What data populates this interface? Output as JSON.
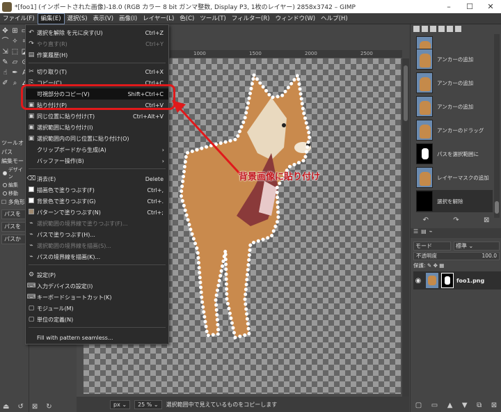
{
  "window": {
    "title": "*[foo1] (インポートされた画像)-18.0 (RGB カラー 8 bit ガンマ整数, Display P3, 1枚のレイヤー) 2858x3742 – GIMP",
    "minimize": "–",
    "maximize": "☐",
    "close": "✕"
  },
  "menubar": [
    "ファイル(F)",
    "編集(E)",
    "選択(S)",
    "表示(V)",
    "画像(I)",
    "レイヤー(L)",
    "色(C)",
    "ツール(T)",
    "フィルター(R)",
    "ウィンドウ(W)",
    "ヘルプ(H)"
  ],
  "edit_menu": {
    "items": [
      {
        "icon": "↶",
        "label": "選択を解除 を元に戻す(U)",
        "shortcut": "Ctrl+Z",
        "disabled": false
      },
      {
        "icon": "↷",
        "label": "やり直す(R)",
        "shortcut": "Ctrl+Y",
        "disabled": true
      },
      {
        "icon": "▤",
        "label": "作業履歴(H)",
        "shortcut": "",
        "disabled": false
      },
      {
        "icon": "✂",
        "label": "切り取り(T)",
        "shortcut": "Ctrl+X",
        "disabled": false
      },
      {
        "icon": "⎘",
        "label": "コピー(C)",
        "shortcut": "Ctrl+C",
        "disabled": false
      },
      {
        "icon": "",
        "label": "可視部分のコピー(V)",
        "shortcut": "Shift+Ctrl+C",
        "disabled": false
      },
      {
        "icon": "▣",
        "label": "貼り付け(P)",
        "shortcut": "Ctrl+V",
        "disabled": false
      },
      {
        "icon": "▣",
        "label": "同じ位置に貼り付け(T)",
        "shortcut": "Ctrl+Alt+V",
        "disabled": false
      },
      {
        "icon": "▣",
        "label": "選択範囲に貼り付け(I)",
        "shortcut": "",
        "disabled": false
      },
      {
        "icon": "▣",
        "label": "選択範囲内の同じ位置に貼り付け(O)",
        "shortcut": "",
        "disabled": false
      },
      {
        "icon": "",
        "label": "クリップボードから生成(A)",
        "shortcut": "",
        "disabled": false,
        "submenu": true
      },
      {
        "icon": "",
        "label": "バッファー操作(B)",
        "shortcut": "",
        "disabled": false,
        "submenu": true
      },
      {
        "icon": "⌫",
        "label": "消去(E)",
        "shortcut": "Delete",
        "disabled": false
      },
      {
        "icon": "■",
        "label": "描画色で塗りつぶす(F)",
        "shortcut": "Ctrl+,",
        "disabled": false
      },
      {
        "icon": "□",
        "label": "背景色で塗りつぶす(G)",
        "shortcut": "Ctrl+.",
        "disabled": false
      },
      {
        "icon": "▦",
        "label": "パターンで塗りつぶす(N)",
        "shortcut": "Ctrl+;",
        "disabled": false
      },
      {
        "icon": "⌁",
        "label": "選択範囲の境界線で塗りつぶす(F)...",
        "shortcut": "",
        "disabled": true
      },
      {
        "icon": "⌁",
        "label": "パスで塗りつぶす(H)...",
        "shortcut": "",
        "disabled": false
      },
      {
        "icon": "⌁",
        "label": "選択範囲の境界線を描画(S)...",
        "shortcut": "",
        "disabled": true
      },
      {
        "icon": "⌁",
        "label": "パスの境界線を描画(K)...",
        "shortcut": "",
        "disabled": false
      },
      {
        "icon": "⚙",
        "label": "設定(P)",
        "shortcut": "",
        "disabled": false
      },
      {
        "icon": "⌨",
        "label": "入力デバイスの設定(I)",
        "shortcut": "",
        "disabled": false
      },
      {
        "icon": "⌨",
        "label": "キーボードショートカット(K)",
        "shortcut": "",
        "disabled": false
      },
      {
        "icon": "▢",
        "label": "モジュール(M)",
        "shortcut": "",
        "disabled": false
      },
      {
        "icon": "▢",
        "label": "単位の定義(N)",
        "shortcut": "",
        "disabled": false
      },
      {
        "icon": "",
        "label": "Fill with pattern seamless...",
        "shortcut": "",
        "disabled": false
      }
    ]
  },
  "annotation": {
    "text": "背景画像に貼り付け",
    "color": "#e0191b"
  },
  "toolbox": {
    "tool_options_label": "ツールオ",
    "paths_label": "パス",
    "edit_mode_label": "編集モード",
    "mode_options": [
      "デザイン",
      "編集",
      "移動"
    ],
    "polygon_label": "多角形",
    "path_buttons": [
      "パスを",
      "パスを",
      "パスか"
    ]
  },
  "ruler": {
    "ticks": [
      "1000",
      "1500",
      "2000",
      "2500"
    ]
  },
  "status": {
    "unit": "px",
    "zoom": "25 %",
    "message": "選択範囲中で見えているものをコピーします"
  },
  "history": [
    {
      "label": "",
      "thumb": "dog"
    },
    {
      "label": "アンカーの追加",
      "thumb": "dog"
    },
    {
      "label": "アンカーの追加",
      "thumb": "dog"
    },
    {
      "label": "アンカーの追加",
      "thumb": "dog"
    },
    {
      "label": "アンカーのドラッグ",
      "thumb": "dog"
    },
    {
      "label": "パスを選択範囲に",
      "thumb": "mask"
    },
    {
      "label": "レイヤーマスクの追加",
      "thumb": "dog"
    },
    {
      "label": "選択を解除",
      "thumb": "black"
    }
  ],
  "layers": {
    "mode_label": "モード",
    "mode_value": "標準",
    "opacity_label": "不透明度",
    "opacity_value": "100.0",
    "lock_label": "保護:",
    "layer_name": "foo1.png"
  }
}
